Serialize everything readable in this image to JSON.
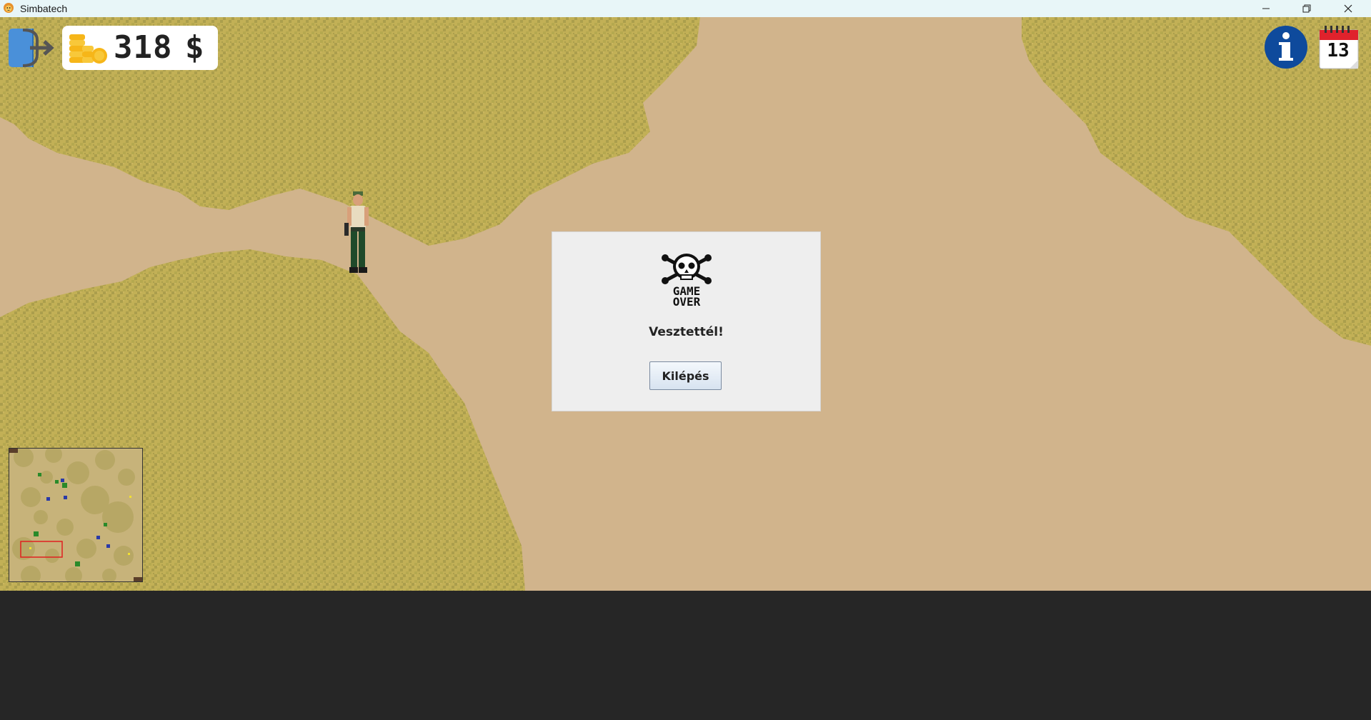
{
  "window": {
    "title": "Simbatech"
  },
  "hud": {
    "money_value": "318",
    "money_currency": "$",
    "calendar_day": "13"
  },
  "dialog": {
    "icon_text_line1": "GAME",
    "icon_text_line2": "OVER",
    "message": "Vesztettél!",
    "button_label": "Kilépés"
  },
  "colors": {
    "sand": "#d1b48c",
    "grass_dark": "#b1a650",
    "grass_light": "#c8b45c",
    "titlebar": "#e8f6f8",
    "background": "#262626",
    "info_blue": "#0e4a9c",
    "exit_blue": "#4a90d9"
  },
  "icons": {
    "exit": "exit-door-icon",
    "coins": "coins-icon",
    "info": "info-icon",
    "calendar": "calendar-icon",
    "skull": "skull-crossbones-icon"
  }
}
